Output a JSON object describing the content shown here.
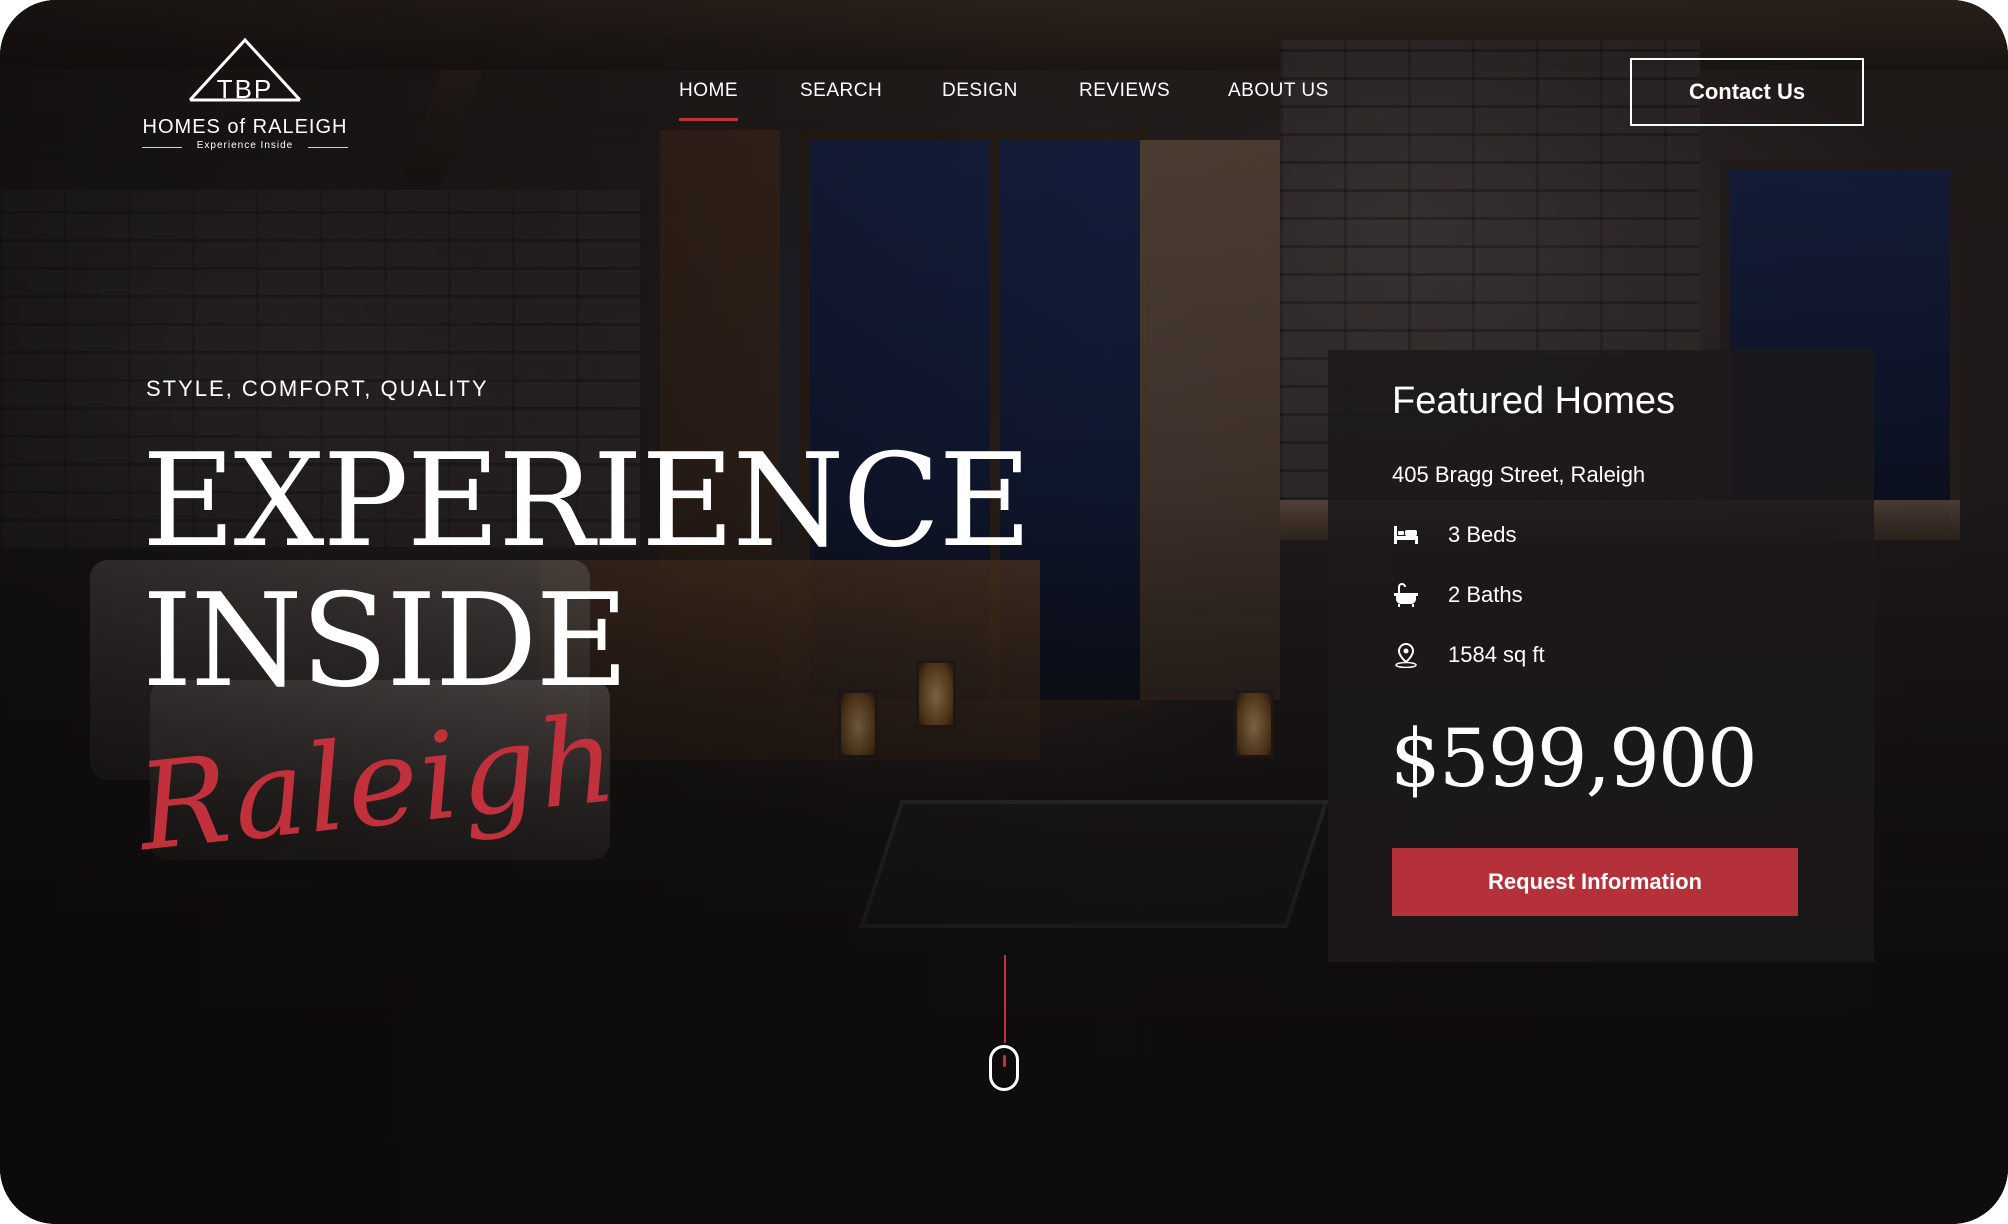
{
  "brand": {
    "monogram": "TBP",
    "name": "HOMES of RALEIGH",
    "tagline": "Experience Inside"
  },
  "nav": {
    "items": [
      "HOME",
      "SEARCH",
      "DESIGN",
      "REVIEWS",
      "ABOUT US"
    ],
    "active": "HOME",
    "contact_label": "Contact Us"
  },
  "hero": {
    "eyebrow": "STYLE, COMFORT, QUALITY",
    "headline_line1": "EXPERIENCE",
    "headline_line2": "INSIDE",
    "script": "Raleigh"
  },
  "featured": {
    "title": "Featured Homes",
    "address": "405 Bragg Street, Raleigh",
    "beds": "3 Beds",
    "baths": "2 Baths",
    "area": "1584 sq ft",
    "price": "$599,900",
    "cta": "Request Information"
  },
  "icons": {
    "beds": "bed-icon",
    "baths": "bathtub-icon",
    "area": "location-pin-icon",
    "scroll": "mouse-scroll-icon"
  },
  "colors": {
    "accent": "#b5313a",
    "background": "#141112",
    "text": "#ffffff"
  }
}
